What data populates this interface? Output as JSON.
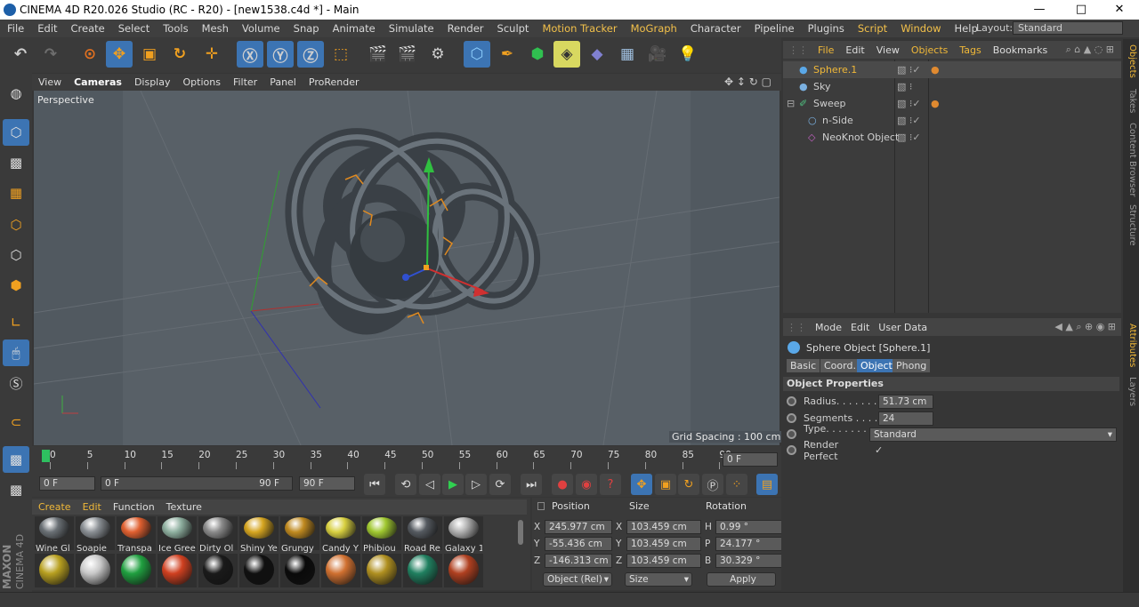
{
  "window": {
    "title": "CINEMA 4D R20.026 Studio (RC - R20) - [new1538.c4d *] - Main",
    "min": "—",
    "max": "□",
    "close": "✕"
  },
  "menu": [
    "File",
    "Edit",
    "Create",
    "Select",
    "Tools",
    "Mesh",
    "Volume",
    "Snap",
    "Animate",
    "Simulate",
    "Render",
    "Sculpt",
    "Motion Tracker",
    "MoGraph",
    "Character",
    "Pipeline",
    "Plugins",
    "Script",
    "Window",
    "Help"
  ],
  "layout": {
    "label": "Layout:",
    "value": "Standard"
  },
  "viewport": {
    "menu": [
      "View",
      "Cameras",
      "Display",
      "Options",
      "Filter",
      "Panel",
      "ProRender"
    ],
    "label": "Perspective",
    "grid_spacing": "Grid Spacing : 100 cm"
  },
  "timeline": {
    "ticks": [
      "0",
      "5",
      "10",
      "15",
      "20",
      "25",
      "30",
      "35",
      "40",
      "45",
      "50",
      "55",
      "60",
      "65",
      "70",
      "75",
      "80",
      "85",
      "90"
    ],
    "current": "0 F",
    "start": "0 F",
    "range_start": "0 F",
    "range_end": "90 F",
    "end": "90 F"
  },
  "materials": {
    "menu": [
      "Create",
      "Edit",
      "Function",
      "Texture"
    ],
    "row1": [
      "Wine Gl",
      "Soapie",
      "Transpa",
      "Ice Gree",
      "Dirty Ol",
      "Shiny Ye",
      "Grungy",
      "Candy Y",
      "Phibiou",
      "Road Re",
      "Galaxy 1"
    ],
    "row1_colors": [
      "#6a7075",
      "#8a8f94",
      "#e06030",
      "#8fb0a0",
      "#8a8a8a",
      "#d6a520",
      "#c08a20",
      "#d8d040",
      "#a0c830",
      "#555a60",
      "#b0b0b0"
    ],
    "row2_colors": [
      "#b8a020",
      "#c8c8c8",
      "#20a040",
      "#d04020",
      "#1a1a1a",
      "#101010",
      "#0a0a0a",
      "#d07030",
      "#b09020",
      "#208060",
      "#b04020"
    ]
  },
  "coords": {
    "headers": [
      "Position",
      "Size",
      "Rotation"
    ],
    "rows": [
      {
        "axis": "X",
        "pos": "245.977 cm",
        "size_axis": "X",
        "size": "103.459 cm",
        "rot_axis": "H",
        "rot": "0.99 °"
      },
      {
        "axis": "Y",
        "pos": "-55.436 cm",
        "size_axis": "Y",
        "size": "103.459 cm",
        "rot_axis": "P",
        "rot": "24.177 °"
      },
      {
        "axis": "Z",
        "pos": "-146.313 cm",
        "size_axis": "Z",
        "size": "103.459 cm",
        "rot_axis": "B",
        "rot": "30.329 °"
      }
    ],
    "mode": "Object (Rel)",
    "size_mode": "Size",
    "apply": "Apply"
  },
  "objects": {
    "menu": [
      "File",
      "Edit",
      "View",
      "Objects",
      "Tags",
      "Bookmarks"
    ],
    "items": [
      "Sphere.1",
      "Sky",
      "Sweep",
      "n-Side",
      "NeoKnot Object"
    ]
  },
  "attributes": {
    "menu": [
      "Mode",
      "Edit",
      "User Data"
    ],
    "title": "Sphere Object [Sphere.1]",
    "tabs": [
      "Basic",
      "Coord.",
      "Object",
      "Phong"
    ],
    "section": "Object Properties",
    "radius_label": "Radius. . . . . . .",
    "radius": "51.73 cm",
    "segments_label": "Segments . . . .",
    "segments": "24",
    "type_label": "Type. . . . . . . . .",
    "type": "Standard",
    "render_label": "Render Perfect",
    "render_check": "✓"
  },
  "sidetabs": [
    "Objects",
    "Takes",
    "Content Browser",
    "Structure",
    "Attributes",
    "Layers"
  ],
  "brand": {
    "maxon": "MAXON",
    "c4d": "CINEMA 4D"
  }
}
